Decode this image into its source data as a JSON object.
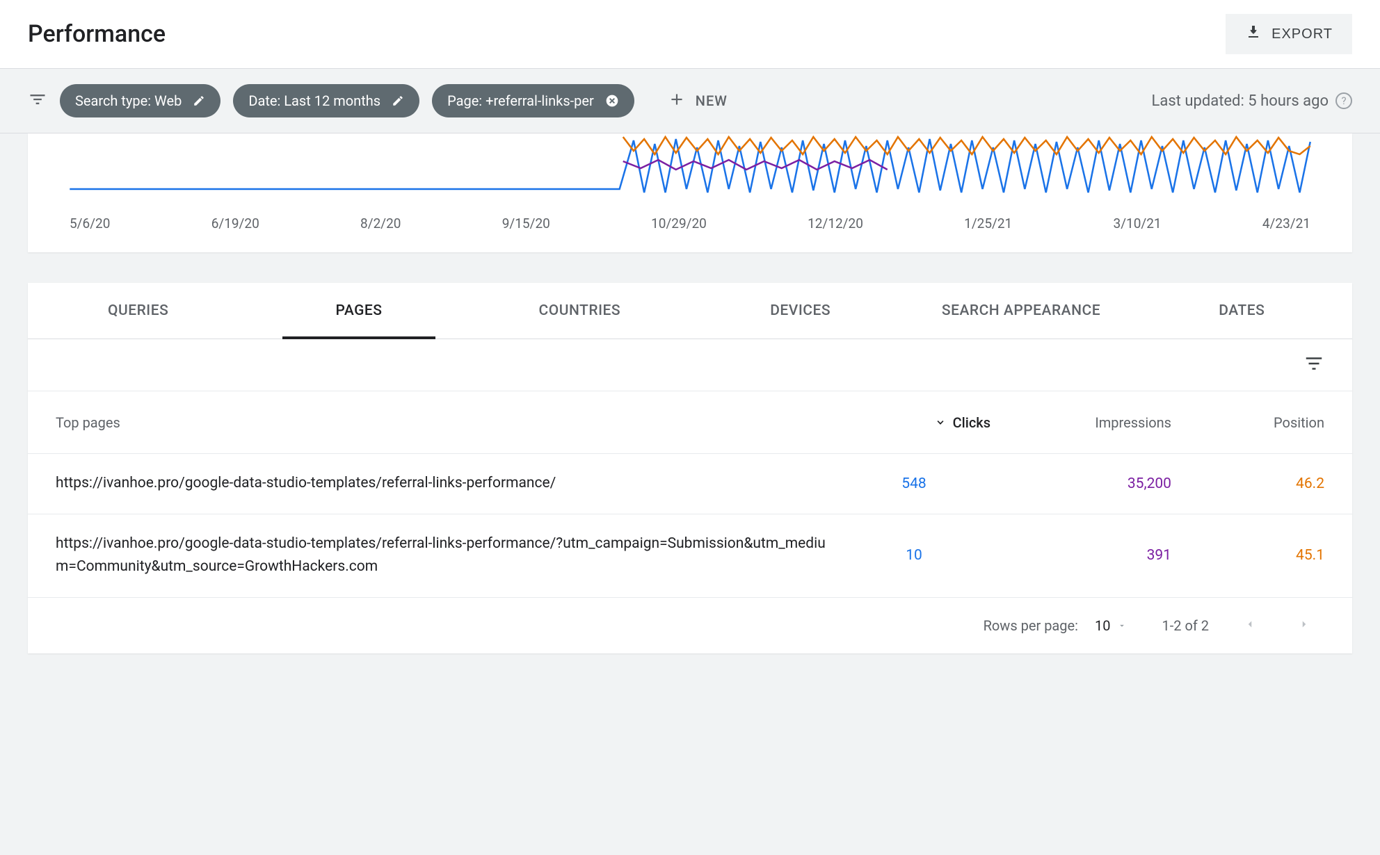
{
  "header": {
    "title": "Performance",
    "export_label": "EXPORT"
  },
  "filters": {
    "chips": [
      {
        "label": "Search type: Web",
        "action": "edit"
      },
      {
        "label": "Date: Last 12 months",
        "action": "edit"
      },
      {
        "label": "Page: +referral-links-per",
        "action": "close"
      }
    ],
    "new_label": "NEW",
    "last_updated": "Last updated: 5 hours ago"
  },
  "chart_data": {
    "type": "line",
    "x_ticks": [
      "5/6/20",
      "6/19/20",
      "8/2/20",
      "9/15/20",
      "10/29/20",
      "12/12/20",
      "1/25/21",
      "3/10/21",
      "4/23/21"
    ],
    "series": [
      {
        "name": "Clicks",
        "color": "#1a73e8"
      },
      {
        "name": "Impressions",
        "color": "#7b1fa2"
      },
      {
        "name": "Position",
        "color": "#e37400"
      }
    ],
    "note": "Flat near zero until ~10/29/20, then oscillating activity across all three series"
  },
  "tabs": [
    "QUERIES",
    "PAGES",
    "COUNTRIES",
    "DEVICES",
    "SEARCH APPEARANCE",
    "DATES"
  ],
  "active_tab": 1,
  "table": {
    "columns": {
      "c0": "Top pages",
      "c1": "Clicks",
      "c2": "Impressions",
      "c3": "Position"
    },
    "sort_column": "Clicks",
    "rows": [
      {
        "url": "https://ivanhoe.pro/google-data-studio-templates/referral-links-performance/",
        "clicks": "548",
        "impressions": "35,200",
        "position": "46.2"
      },
      {
        "url": "https://ivanhoe.pro/google-data-studio-templates/referral-links-performance/?utm_campaign=Submission&utm_medium=Community&utm_source=GrowthHackers.com",
        "clicks": "10",
        "impressions": "391",
        "position": "45.1"
      }
    ]
  },
  "pagination": {
    "rows_per_page_label": "Rows per page:",
    "rows_per_page_value": "10",
    "range": "1-2 of 2"
  }
}
